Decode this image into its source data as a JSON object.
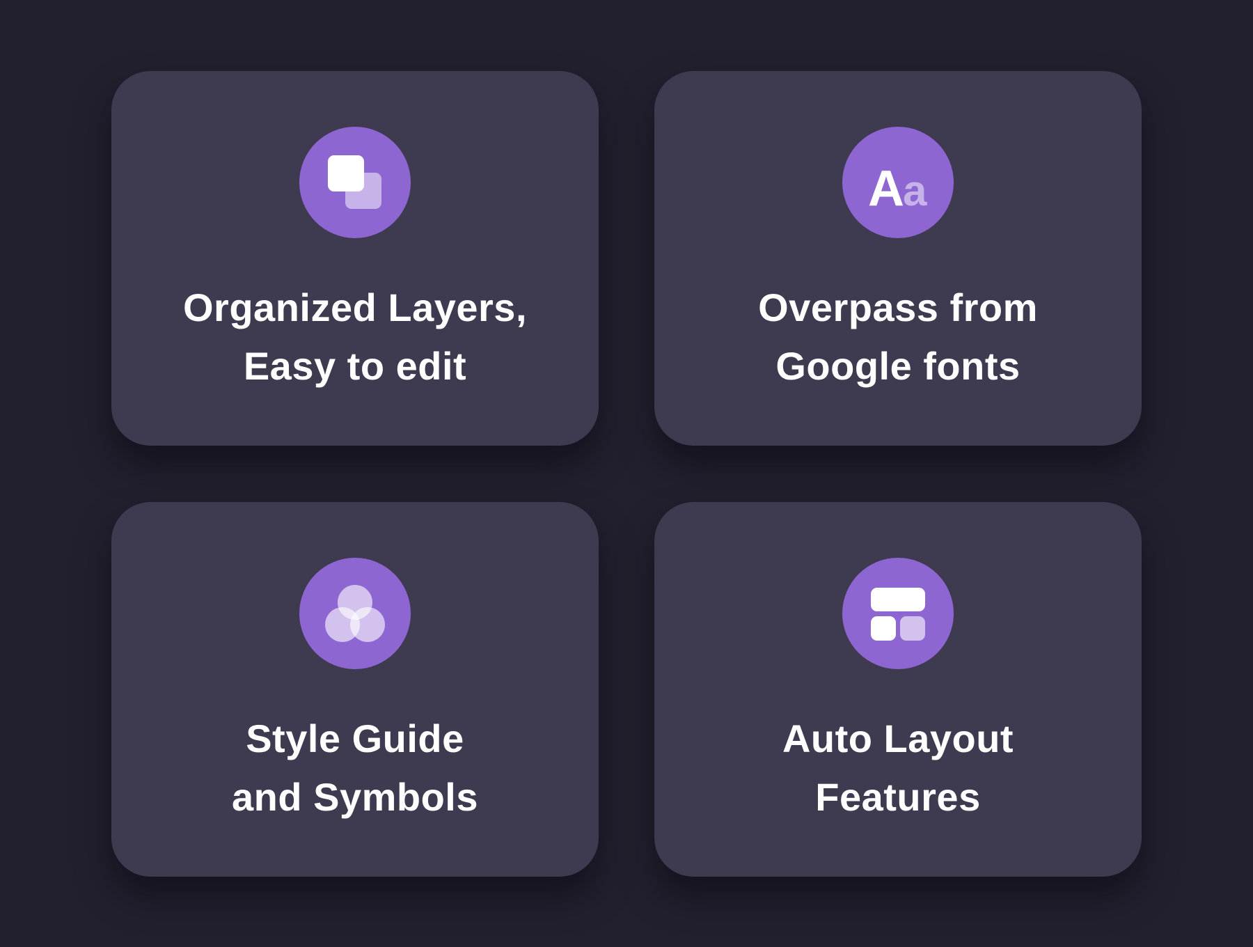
{
  "features": [
    {
      "icon": "layers-icon",
      "title_line1": "Organized Layers,",
      "title_line2": "Easy to edit"
    },
    {
      "icon": "typography-icon",
      "icon_text_big": "A",
      "icon_text_small": "a",
      "title_line1": "Overpass from",
      "title_line2": "Google fonts"
    },
    {
      "icon": "components-icon",
      "title_line1": "Style Guide",
      "title_line2": "and Symbols"
    },
    {
      "icon": "layout-icon",
      "title_line1": "Auto Layout",
      "title_line2": "Features"
    }
  ],
  "colors": {
    "background": "#22202e",
    "card": "#3e3b50",
    "accent": "#8e66d2",
    "text": "#ffffff"
  }
}
